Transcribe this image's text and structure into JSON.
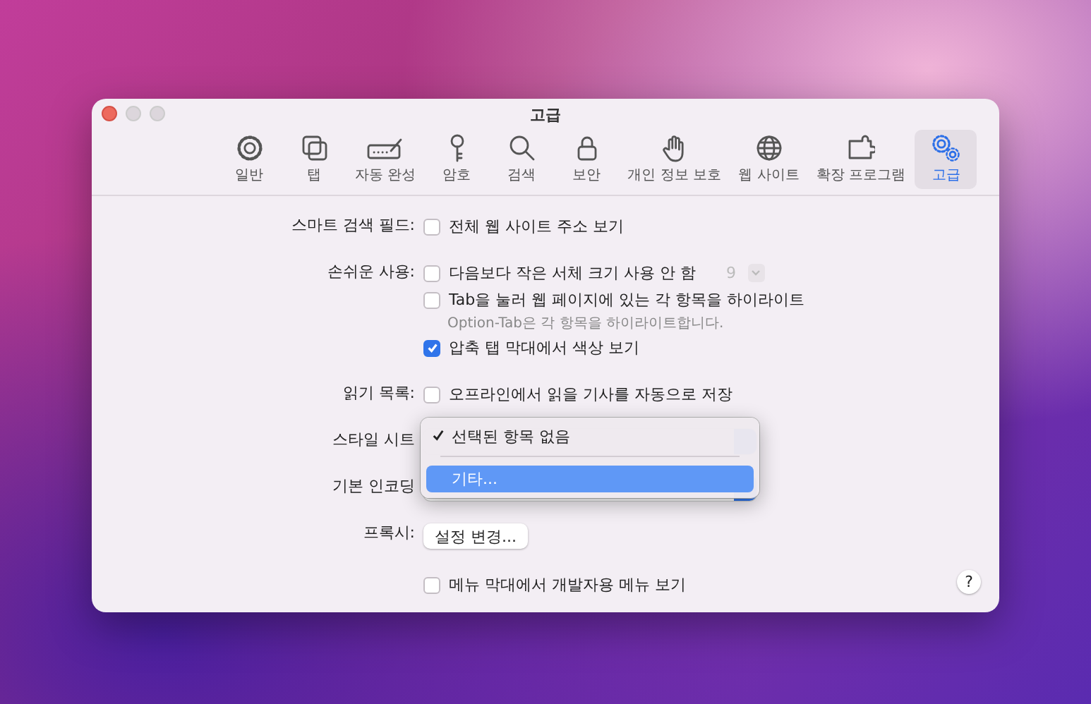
{
  "window": {
    "title": "고급"
  },
  "toolbar": [
    {
      "label": "일반",
      "selected": false
    },
    {
      "label": "탭",
      "selected": false
    },
    {
      "label": "자동 완성",
      "selected": false
    },
    {
      "label": "암호",
      "selected": false
    },
    {
      "label": "검색",
      "selected": false
    },
    {
      "label": "보안",
      "selected": false
    },
    {
      "label": "개인 정보 보호",
      "selected": false
    },
    {
      "label": "웹 사이트",
      "selected": false
    },
    {
      "label": "확장 프로그램",
      "selected": false
    },
    {
      "label": "고급",
      "selected": true
    }
  ],
  "sections": [
    {
      "label": "스마트 검색 필드:",
      "controls": [
        {
          "kind": "checkbox",
          "label": "전체 웹 사이트 주소 보기",
          "checked": false
        }
      ]
    },
    {
      "label": "손쉬운 사용:",
      "controls": [
        {
          "kind": "checkbox",
          "label": "다음보다 작은 서체 크기 사용 안 함",
          "checked": false,
          "stepper": {
            "value": "9",
            "disabled": true
          }
        },
        {
          "kind": "checkbox",
          "label": "Tab을 눌러 웹 페이지에 있는 각 항목을 하이라이트",
          "checked": false
        },
        {
          "kind": "hint",
          "text": "Option-Tab은 각 항목을 하이라이트합니다."
        },
        {
          "kind": "checkbox",
          "label": "압축 탭 막대에서 색상 보기",
          "checked": true
        }
      ]
    },
    {
      "label": "읽기 목록:",
      "controls": [
        {
          "kind": "checkbox",
          "label": "오프라인에서 읽을 기사를 자동으로 저장",
          "checked": false
        }
      ]
    },
    {
      "label": "스타일 시트",
      "controls": [
        {
          "kind": "popup"
        }
      ]
    },
    {
      "label": "기본 인코딩",
      "controls": [
        {
          "kind": "popup"
        }
      ]
    },
    {
      "label": "프록시:",
      "controls": [
        {
          "kind": "button",
          "label": "설정 변경..."
        }
      ]
    },
    {
      "controls": [
        {
          "kind": "checkbox",
          "label": "메뉴 막대에서 개발자용 메뉴 보기",
          "checked": false
        }
      ]
    }
  ],
  "menu": {
    "items": [
      {
        "kind": "item",
        "label": "선택된 항목 없음",
        "checked": true,
        "selected": false
      },
      {
        "kind": "separator"
      },
      {
        "kind": "item",
        "label": "기타...",
        "checked": false,
        "selected": true
      }
    ]
  },
  "help": {
    "label": "?"
  }
}
